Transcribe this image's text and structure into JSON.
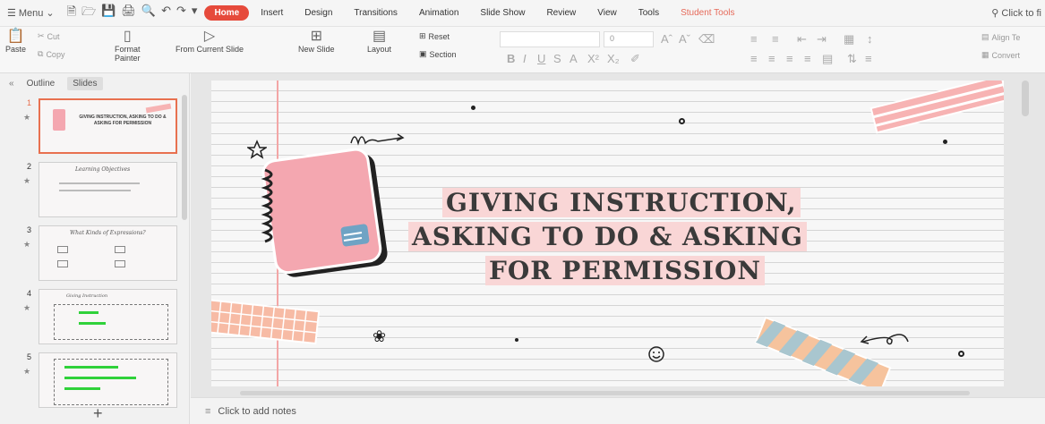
{
  "menubar": {
    "menu_label": "Menu",
    "tabs": [
      {
        "label": "Home",
        "active": true
      },
      {
        "label": "Insert"
      },
      {
        "label": "Design"
      },
      {
        "label": "Transitions"
      },
      {
        "label": "Animation"
      },
      {
        "label": "Slide Show"
      },
      {
        "label": "Review"
      },
      {
        "label": "View"
      },
      {
        "label": "Tools"
      },
      {
        "label": "Student Tools"
      }
    ],
    "search_label": "Click to fi"
  },
  "ribbon": {
    "paste": "Paste",
    "cut": "Cut",
    "copy": "Copy",
    "format_painter_1": "Format",
    "format_painter_2": "Painter",
    "from_current_slide": "From Current Slide",
    "new_slide": "New Slide",
    "layout": "Layout",
    "reset": "Reset",
    "section": "Section",
    "font_size": "0",
    "align_text": "Align Te",
    "convert": "Convert"
  },
  "left_pane": {
    "tab_outline": "Outline",
    "tab_slides": "Slides",
    "slides": [
      {
        "num": "1",
        "title": "GIVING INSTRUCTION, ASKING TO DO & ASKING FOR PERMISSION"
      },
      {
        "num": "2",
        "title": "Learning Objectives"
      },
      {
        "num": "3",
        "title": "What Kinds of Expressions?"
      },
      {
        "num": "4",
        "title": "Giving Instruction"
      },
      {
        "num": "5",
        "title": ""
      }
    ],
    "add_button": "+"
  },
  "slide": {
    "title_line1": "GIVING INSTRUCTION,",
    "title_line2": "ASKING TO DO & ASKING",
    "title_line3": "FOR PERMISSION"
  },
  "notes": {
    "placeholder": "Click to add notes"
  },
  "colors": {
    "accent": "#e64a3b",
    "notebook_pink": "#f4a7b0",
    "tape_pink": "#f7b3b3",
    "tape_blue": "#a9c6cf",
    "tape_peach": "#f6c39d"
  }
}
